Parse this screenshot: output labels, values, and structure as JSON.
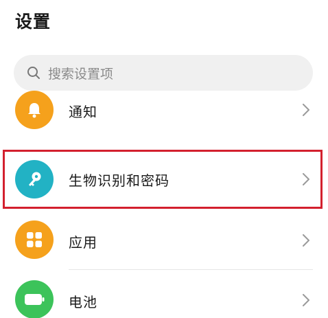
{
  "header": {
    "title": "设置"
  },
  "search": {
    "placeholder": "搜索设置项"
  },
  "settings": {
    "items": [
      {
        "label": "通知",
        "icon": "bell-icon",
        "color": "#f5a11c"
      },
      {
        "label": "生物识别和密码",
        "icon": "key-icon",
        "color": "#22b2c4",
        "highlighted": true
      },
      {
        "label": "应用",
        "icon": "apps-grid-icon",
        "color": "#f5a11c"
      },
      {
        "label": "电池",
        "icon": "battery-icon",
        "color": "#3cc35a"
      }
    ]
  },
  "colors": {
    "highlight_border": "#d3202e",
    "orange": "#f5a11c",
    "teal": "#22b2c4",
    "green": "#3cc35a"
  }
}
